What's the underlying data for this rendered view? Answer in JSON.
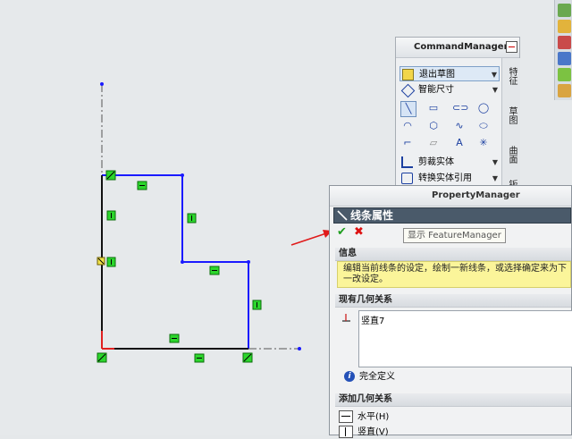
{
  "command_manager": {
    "title": "CommandManager",
    "rows": [
      {
        "label": "退出草图",
        "icon": "exit-sketch-icon"
      },
      {
        "label": "智能尺寸",
        "icon": "smart-dimension-icon"
      },
      {
        "label": "剪裁实体",
        "icon": "trim-entities-icon"
      },
      {
        "label": "转换实体引用",
        "icon": "convert-entities-icon"
      }
    ],
    "tabs": [
      "特征",
      "草图",
      "曲面",
      "钣金"
    ]
  },
  "property_manager": {
    "title": "PropertyManager",
    "header": "线条属性",
    "tooltip": "显示 FeatureManager",
    "info": {
      "title": "信息",
      "text": "编辑当前线条的设定，绘制一新线条，或选择确定来为下一改设定。"
    },
    "existing_relations": {
      "title": "现有几何关系",
      "items": [
        "竖直7"
      ],
      "status": "完全定义"
    },
    "add_relations": {
      "title": "添加几何关系",
      "items": [
        "水平(H)",
        "竖直(V)"
      ]
    }
  },
  "colors": {
    "sketch_line": "#1a1aff",
    "selected_line": "#111111",
    "relation_marker": "#22cc22",
    "ok": "#1f9e1f",
    "cancel": "#dd1111"
  }
}
